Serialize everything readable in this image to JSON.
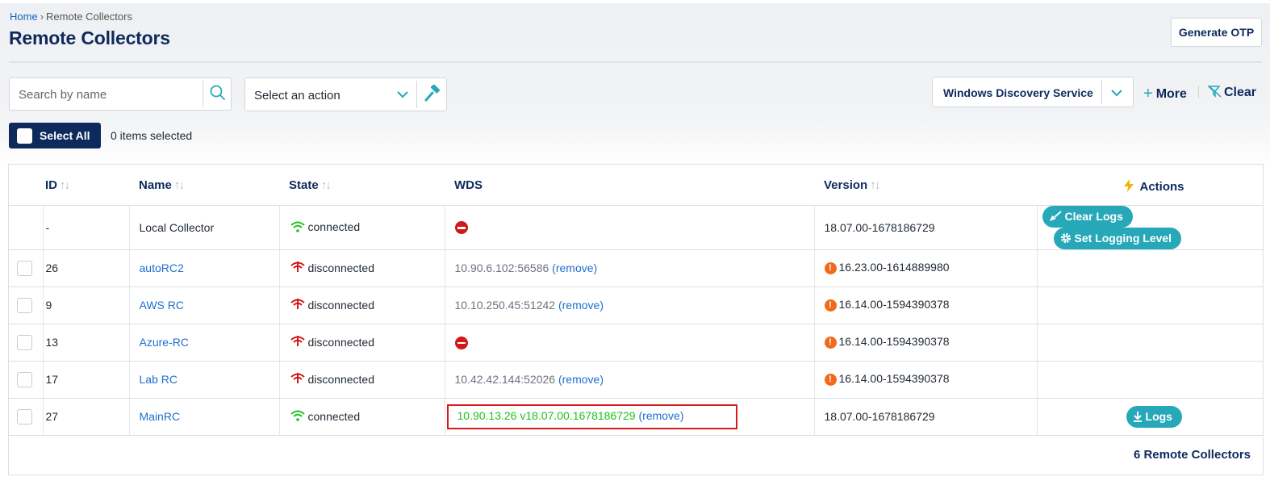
{
  "breadcrumb": {
    "home": "Home",
    "separator": "›",
    "current": "Remote Collectors"
  },
  "page_title": "Remote Collectors",
  "generate_otp_label": "Generate OTP",
  "search": {
    "placeholder": "Search by name"
  },
  "action_select": {
    "value": "Select an action"
  },
  "filter": {
    "wds_value": "Windows Discovery Service",
    "more_label": "More",
    "clear_label": "Clear"
  },
  "selection": {
    "select_all_label": "Select All",
    "items_selected": "0 items selected"
  },
  "table": {
    "headers": {
      "id": "ID",
      "name": "Name",
      "state": "State",
      "wds": "WDS",
      "version": "Version",
      "actions": "Actions"
    },
    "sort_glyph": "↑↓",
    "remove_label": "(remove)",
    "rows": [
      {
        "id": "-",
        "name": "Local Collector",
        "state": "connected",
        "wds": "",
        "wds_status": "none",
        "version": "18.07.00-1678186729",
        "version_warning": false,
        "actions": [
          "Clear Logs",
          "Set Logging Level"
        ]
      },
      {
        "id": "26",
        "name": "autoRC2",
        "state": "disconnected",
        "wds": "10.90.6.102:56586",
        "version": "16.23.00-1614889980",
        "version_warning": true
      },
      {
        "id": "9",
        "name": "AWS RC",
        "state": "disconnected",
        "wds": "10.10.250.45:51242",
        "version": "16.14.00-1594390378",
        "version_warning": true
      },
      {
        "id": "13",
        "name": "Azure-RC",
        "state": "disconnected",
        "wds": "",
        "wds_status": "none",
        "version": "16.14.00-1594390378",
        "version_warning": true
      },
      {
        "id": "17",
        "name": "Lab RC",
        "state": "disconnected",
        "wds": "10.42.42.144:52026",
        "version": "16.14.00-1594390378",
        "version_warning": true
      },
      {
        "id": "27",
        "name": "MainRC",
        "state": "connected",
        "wds": "10.90.13.26 v18.07.00.1678186729",
        "wds_highlighted": true,
        "version": "18.07.00-1678186729",
        "version_warning": false,
        "actions": [
          "Logs"
        ]
      }
    ]
  },
  "footer": {
    "count_label": "6 Remote Collectors"
  },
  "colors": {
    "navy": "#0e2a5c",
    "teal": "#26a8b8",
    "link": "#1e6fd0",
    "connected": "#1fc21f",
    "disconnected": "#d01818",
    "warning": "#f26a1b",
    "highlight_border": "#d81919"
  }
}
